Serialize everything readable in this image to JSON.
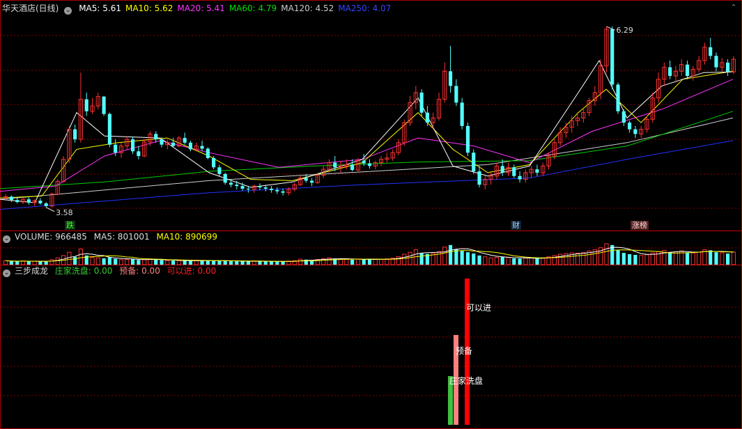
{
  "main": {
    "title": "华天酒店(日线)",
    "ma": [
      {
        "label": "MA5: 5.61",
        "color": "#ffffff"
      },
      {
        "label": "MA10: 5.62",
        "color": "#ffff00"
      },
      {
        "label": "MA20: 5.41",
        "color": "#ff33ff"
      },
      {
        "label": "MA60: 4.79",
        "color": "#00e000"
      },
      {
        "label": "MA120: 4.52",
        "color": "#cccccc"
      },
      {
        "label": "MA250: 4.07",
        "color": "#3344ff"
      }
    ],
    "max_label": "6.29",
    "min_label": "3.58",
    "tag_die": "跌",
    "tag_cai": "财",
    "tag_bang": "涨榜"
  },
  "volume": {
    "label": "VOLUME: 966485",
    "ma5": "MA5: 801001",
    "ma10": "MA10: 890699"
  },
  "indicator": {
    "name": "三步成龙",
    "s1": "庄家洗盘: 0.00",
    "s2": "预备: 0.00",
    "s3": "可以进: 0.00",
    "bar1_label": "庄家洗盘",
    "bar2_label": "预备",
    "bar3_label": "可以进"
  },
  "colors": {
    "up": "#ff3232",
    "down": "#54ffff",
    "grid": "#8a0000",
    "bg": "#000000",
    "ma250": "#2233ff",
    "ma120": "#d0d0d0",
    "ma60": "#00d000",
    "ma20": "#ff33ff",
    "ma10": "#ffff00",
    "ma5": "#ffffff"
  },
  "chart_data": {
    "type": "candlestick",
    "yrange": [
      3.4,
      6.5
    ],
    "ohlc": [
      [
        3.72,
        3.78,
        3.68,
        3.74
      ],
      [
        3.74,
        3.76,
        3.66,
        3.69
      ],
      [
        3.69,
        3.73,
        3.64,
        3.66
      ],
      [
        3.66,
        3.72,
        3.63,
        3.7
      ],
      [
        3.7,
        3.73,
        3.62,
        3.65
      ],
      [
        3.65,
        3.7,
        3.6,
        3.68
      ],
      [
        3.68,
        3.72,
        3.62,
        3.64
      ],
      [
        3.64,
        3.66,
        3.58,
        3.6
      ],
      [
        3.6,
        3.8,
        3.58,
        3.78
      ],
      [
        3.78,
        4.0,
        3.76,
        3.97
      ],
      [
        3.97,
        4.35,
        3.95,
        4.3
      ],
      [
        4.3,
        4.8,
        4.25,
        4.75
      ],
      [
        4.75,
        4.82,
        4.55,
        4.6
      ],
      [
        4.6,
        5.6,
        4.55,
        5.2
      ],
      [
        5.2,
        5.3,
        4.95,
        5.02
      ],
      [
        5.02,
        5.22,
        4.98,
        5.1
      ],
      [
        5.1,
        5.3,
        5.05,
        5.24
      ],
      [
        5.24,
        5.25,
        4.95,
        4.98
      ],
      [
        4.98,
        5.0,
        4.48,
        4.52
      ],
      [
        4.52,
        4.6,
        4.35,
        4.4
      ],
      [
        4.4,
        4.55,
        4.32,
        4.5
      ],
      [
        4.5,
        4.65,
        4.45,
        4.6
      ],
      [
        4.6,
        4.64,
        4.38,
        4.42
      ],
      [
        4.42,
        4.5,
        4.3,
        4.35
      ],
      [
        4.35,
        4.6,
        4.33,
        4.56
      ],
      [
        4.56,
        4.72,
        4.5,
        4.68
      ],
      [
        4.68,
        4.72,
        4.55,
        4.6
      ],
      [
        4.6,
        4.63,
        4.48,
        4.52
      ],
      [
        4.52,
        4.6,
        4.45,
        4.55
      ],
      [
        4.55,
        4.62,
        4.48,
        4.5
      ],
      [
        4.5,
        4.65,
        4.48,
        4.62
      ],
      [
        4.62,
        4.7,
        4.52,
        4.55
      ],
      [
        4.55,
        4.58,
        4.42,
        4.45
      ],
      [
        4.45,
        4.55,
        4.42,
        4.5
      ],
      [
        4.5,
        4.58,
        4.42,
        4.46
      ],
      [
        4.46,
        4.48,
        4.3,
        4.32
      ],
      [
        4.32,
        4.35,
        4.15,
        4.18
      ],
      [
        4.18,
        4.22,
        4.05,
        4.08
      ],
      [
        4.08,
        4.1,
        3.92,
        3.95
      ],
      [
        3.95,
        4.0,
        3.88,
        3.92
      ],
      [
        3.92,
        3.98,
        3.85,
        3.9
      ],
      [
        3.9,
        3.95,
        3.83,
        3.86
      ],
      [
        3.86,
        3.9,
        3.8,
        3.85
      ],
      [
        3.85,
        3.92,
        3.8,
        3.9
      ],
      [
        3.9,
        3.94,
        3.84,
        3.88
      ],
      [
        3.88,
        3.92,
        3.82,
        3.86
      ],
      [
        3.86,
        3.9,
        3.8,
        3.84
      ],
      [
        3.84,
        3.88,
        3.78,
        3.82
      ],
      [
        3.82,
        3.86,
        3.76,
        3.8
      ],
      [
        3.8,
        3.88,
        3.76,
        3.85
      ],
      [
        3.85,
        3.95,
        3.82,
        3.92
      ],
      [
        3.92,
        4.05,
        3.9,
        4.02
      ],
      [
        4.02,
        4.08,
        3.95,
        3.98
      ],
      [
        3.98,
        4.02,
        3.9,
        3.95
      ],
      [
        3.95,
        4.1,
        3.93,
        4.06
      ],
      [
        4.06,
        4.2,
        4.02,
        4.15
      ],
      [
        4.15,
        4.3,
        4.1,
        4.25
      ],
      [
        4.25,
        4.35,
        4.12,
        4.18
      ],
      [
        4.18,
        4.28,
        4.1,
        4.2
      ],
      [
        4.2,
        4.3,
        4.15,
        4.22
      ],
      [
        4.22,
        4.3,
        4.12,
        4.14
      ],
      [
        4.14,
        4.32,
        4.1,
        4.28
      ],
      [
        4.28,
        4.38,
        4.2,
        4.24
      ],
      [
        4.24,
        4.3,
        4.16,
        4.2
      ],
      [
        4.2,
        4.28,
        4.15,
        4.25
      ],
      [
        4.25,
        4.35,
        4.2,
        4.3
      ],
      [
        4.3,
        4.4,
        4.25,
        4.32
      ],
      [
        4.32,
        4.45,
        4.28,
        4.4
      ],
      [
        4.4,
        4.6,
        4.36,
        4.55
      ],
      [
        4.55,
        4.9,
        4.5,
        4.85
      ],
      [
        4.85,
        5.25,
        4.8,
        5.15
      ],
      [
        5.15,
        5.4,
        5.05,
        5.3
      ],
      [
        5.3,
        5.35,
        4.95,
        5.0
      ],
      [
        5.0,
        5.1,
        4.8,
        4.85
      ],
      [
        4.85,
        5.0,
        4.75,
        4.92
      ],
      [
        4.92,
        5.3,
        4.88,
        5.2
      ],
      [
        5.2,
        5.75,
        5.15,
        5.62
      ],
      [
        5.62,
        6.0,
        5.3,
        5.4
      ],
      [
        5.4,
        5.5,
        5.1,
        5.15
      ],
      [
        5.15,
        5.22,
        4.75,
        4.8
      ],
      [
        4.8,
        4.85,
        4.35,
        4.4
      ],
      [
        4.4,
        4.45,
        4.08,
        4.12
      ],
      [
        4.12,
        4.2,
        3.88,
        3.92
      ],
      [
        3.92,
        4.05,
        3.85,
        4.0
      ],
      [
        4.0,
        4.1,
        3.92,
        4.05
      ],
      [
        4.05,
        4.25,
        4.0,
        4.2
      ],
      [
        4.2,
        4.3,
        4.05,
        4.1
      ],
      [
        4.1,
        4.25,
        4.05,
        4.18
      ],
      [
        4.18,
        4.22,
        4.02,
        4.05
      ],
      [
        4.05,
        4.12,
        3.95,
        4.0
      ],
      [
        4.0,
        4.15,
        3.95,
        4.1
      ],
      [
        4.1,
        4.2,
        4.02,
        4.15
      ],
      [
        4.15,
        4.22,
        4.05,
        4.1
      ],
      [
        4.1,
        4.25,
        4.05,
        4.2
      ],
      [
        4.2,
        4.4,
        4.15,
        4.35
      ],
      [
        4.35,
        4.6,
        4.3,
        4.55
      ],
      [
        4.55,
        4.78,
        4.5,
        4.7
      ],
      [
        4.7,
        4.85,
        4.62,
        4.78
      ],
      [
        4.78,
        4.95,
        4.7,
        4.88
      ],
      [
        4.88,
        4.98,
        4.8,
        4.92
      ],
      [
        4.92,
        5.05,
        4.85,
        5.0
      ],
      [
        5.0,
        5.22,
        4.95,
        5.18
      ],
      [
        5.18,
        5.4,
        5.1,
        5.3
      ],
      [
        5.3,
        5.8,
        5.2,
        5.7
      ],
      [
        5.7,
        6.29,
        5.6,
        6.25
      ],
      [
        6.25,
        6.29,
        5.35,
        5.42
      ],
      [
        5.42,
        5.45,
        4.98,
        5.02
      ],
      [
        5.02,
        5.05,
        4.8,
        4.85
      ],
      [
        4.85,
        4.88,
        4.7,
        4.75
      ],
      [
        4.75,
        4.8,
        4.62,
        4.68
      ],
      [
        4.68,
        4.8,
        4.62,
        4.75
      ],
      [
        4.75,
        4.95,
        4.7,
        4.9
      ],
      [
        4.9,
        5.3,
        4.85,
        5.22
      ],
      [
        5.22,
        5.6,
        5.15,
        5.5
      ],
      [
        5.5,
        5.75,
        5.4,
        5.68
      ],
      [
        5.68,
        5.78,
        5.5,
        5.55
      ],
      [
        5.55,
        5.7,
        5.45,
        5.62
      ],
      [
        5.62,
        5.8,
        5.55,
        5.72
      ],
      [
        5.72,
        5.78,
        5.5,
        5.55
      ],
      [
        5.55,
        5.7,
        5.48,
        5.65
      ],
      [
        5.65,
        5.85,
        5.6,
        5.78
      ],
      [
        5.78,
        6.05,
        5.72,
        5.98
      ],
      [
        5.98,
        6.12,
        5.8,
        5.85
      ],
      [
        5.85,
        5.9,
        5.62,
        5.68
      ],
      [
        5.68,
        5.82,
        5.6,
        5.75
      ],
      [
        5.75,
        5.8,
        5.55,
        5.61
      ],
      [
        5.61,
        5.85,
        5.58,
        5.8
      ]
    ],
    "volume": [
      300,
      260,
      240,
      280,
      250,
      270,
      240,
      230,
      380,
      520,
      700,
      950,
      600,
      1200,
      700,
      560,
      520,
      480,
      560,
      450,
      380,
      400,
      420,
      360,
      380,
      420,
      380,
      340,
      320,
      310,
      300,
      300,
      290,
      300,
      310,
      330,
      300,
      280,
      300,
      260,
      250,
      260,
      250,
      280,
      260,
      250,
      240,
      230,
      250,
      270,
      300,
      420,
      380,
      340,
      400,
      460,
      520,
      470,
      420,
      400,
      380,
      430,
      400,
      380,
      400,
      420,
      450,
      500,
      620,
      800,
      950,
      1150,
      900,
      820,
      850,
      1000,
      1350,
      1500,
      1200,
      1050,
      950,
      850,
      700,
      600,
      520,
      560,
      600,
      540,
      480,
      460,
      500,
      520,
      480,
      520,
      600,
      700,
      800,
      850,
      900,
      880,
      920,
      1050,
      1150,
      1300,
      1600,
      1500,
      1100,
      900,
      800,
      750,
      700,
      760,
      900,
      1000,
      1100,
      950,
      980,
      1050,
      920,
      900,
      960,
      1150,
      1100,
      950,
      900,
      850,
      966
    ],
    "ma_lines": {
      "ma250": [
        [
          0,
          3.55
        ],
        [
          300,
          3.8
        ],
        [
          520,
          3.92
        ],
        [
          760,
          4.02
        ],
        [
          900,
          4.3
        ],
        [
          1052,
          4.58
        ]
      ],
      "ma120": [
        [
          0,
          3.7
        ],
        [
          300,
          3.98
        ],
        [
          500,
          4.1
        ],
        [
          700,
          4.22
        ],
        [
          900,
          4.55
        ],
        [
          1052,
          4.92
        ]
      ],
      "ma60": [
        [
          0,
          3.86
        ],
        [
          150,
          3.96
        ],
        [
          300,
          4.12
        ],
        [
          450,
          4.2
        ],
        [
          600,
          4.26
        ],
        [
          760,
          4.28
        ],
        [
          900,
          4.5
        ],
        [
          1052,
          5.02
        ]
      ],
      "ma20": [
        [
          0,
          3.82
        ],
        [
          80,
          3.9
        ],
        [
          150,
          4.35
        ],
        [
          230,
          4.58
        ],
        [
          300,
          4.4
        ],
        [
          400,
          4.18
        ],
        [
          520,
          4.3
        ],
        [
          600,
          4.62
        ],
        [
          680,
          4.5
        ],
        [
          760,
          4.25
        ],
        [
          850,
          4.72
        ],
        [
          950,
          5.05
        ],
        [
          1052,
          5.5
        ]
      ],
      "ma10": [
        [
          0,
          3.72
        ],
        [
          60,
          3.75
        ],
        [
          110,
          4.45
        ],
        [
          170,
          4.55
        ],
        [
          240,
          4.62
        ],
        [
          300,
          4.35
        ],
        [
          360,
          4.0
        ],
        [
          420,
          3.98
        ],
        [
          520,
          4.25
        ],
        [
          600,
          5.0
        ],
        [
          650,
          4.45
        ],
        [
          700,
          4.1
        ],
        [
          760,
          4.22
        ],
        [
          830,
          5.0
        ],
        [
          870,
          5.35
        ],
        [
          920,
          4.85
        ],
        [
          980,
          5.5
        ],
        [
          1052,
          5.62
        ]
      ],
      "ma5": [
        [
          0,
          3.7
        ],
        [
          50,
          3.65
        ],
        [
          110,
          5.0
        ],
        [
          150,
          4.65
        ],
        [
          230,
          4.62
        ],
        [
          300,
          4.1
        ],
        [
          360,
          3.88
        ],
        [
          420,
          3.96
        ],
        [
          520,
          4.3
        ],
        [
          600,
          5.22
        ],
        [
          650,
          4.2
        ],
        [
          700,
          4.05
        ],
        [
          760,
          4.2
        ],
        [
          830,
          5.3
        ],
        [
          860,
          5.78
        ],
        [
          900,
          4.92
        ],
        [
          950,
          5.4
        ],
        [
          1010,
          5.6
        ],
        [
          1052,
          5.61
        ]
      ]
    }
  }
}
